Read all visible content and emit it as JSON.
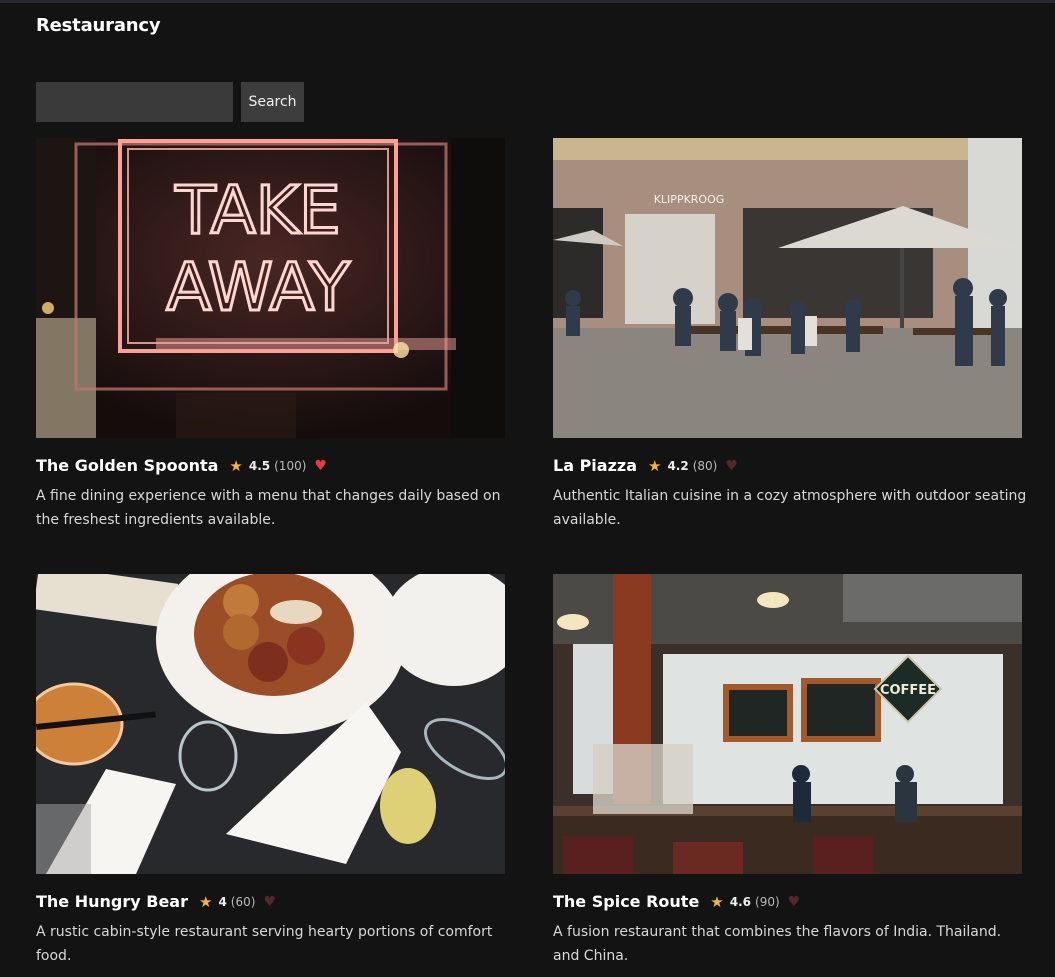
{
  "app": {
    "title": "Restaurancy"
  },
  "search": {
    "placeholder": "",
    "value": "",
    "button_label": "Search"
  },
  "colors": {
    "background": "#131314",
    "star": "#f3b53f",
    "heart_active": "#e53b3b",
    "heart_inactive": "#55262a"
  },
  "restaurants": [
    {
      "name": "The Golden Spoonta",
      "rating": "4.5",
      "count": "(100)",
      "favorite": true,
      "star_icon": "★",
      "heart_icon": "♥",
      "image_icon": "neon-takeaway-sign-photo",
      "description": "A fine dining experience with a menu that changes daily based on the freshest ingredients available."
    },
    {
      "name": "La Piazza",
      "rating": "4.2",
      "count": "(80)",
      "favorite": false,
      "star_icon": "★",
      "heart_icon": "♥",
      "image_icon": "outdoor-cafe-terrace-photo",
      "description": "Authentic Italian cuisine in a cozy atmosphere with outdoor seating available."
    },
    {
      "name": "The Hungry Bear",
      "rating": "4",
      "count": "(60)",
      "favorite": false,
      "star_icon": "★",
      "heart_icon": "♥",
      "image_icon": "meatball-plate-table-photo",
      "description": "A rustic cabin-style restaurant serving hearty portions of comfort food."
    },
    {
      "name": "The Spice Route",
      "rating": "4.6",
      "count": "(90)",
      "favorite": false,
      "star_icon": "★",
      "heart_icon": "♥",
      "image_icon": "coffee-shop-interior-photo",
      "description": "A fusion restaurant that combines the flavors of India. Thailand. and China."
    }
  ]
}
